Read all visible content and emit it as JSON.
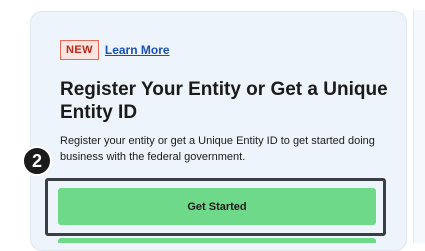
{
  "badge": {
    "text": "NEW"
  },
  "learn_more": {
    "label": "Learn More"
  },
  "card": {
    "title": "Register Your Entity or Get a Unique Entity ID",
    "description": "Register your entity or get a Unique Entity ID to get started doing business with the federal government."
  },
  "callout": {
    "step_number": "2"
  },
  "primary_button": {
    "label": "Get Started"
  },
  "colors": {
    "card_bg": "#eef4fb",
    "badge_border": "#e36a59",
    "badge_bg": "#fde4de",
    "badge_text": "#b6291b",
    "link": "#1a4fb5",
    "button_bg": "#6fd98a",
    "highlight_border": "#3b3f45"
  }
}
